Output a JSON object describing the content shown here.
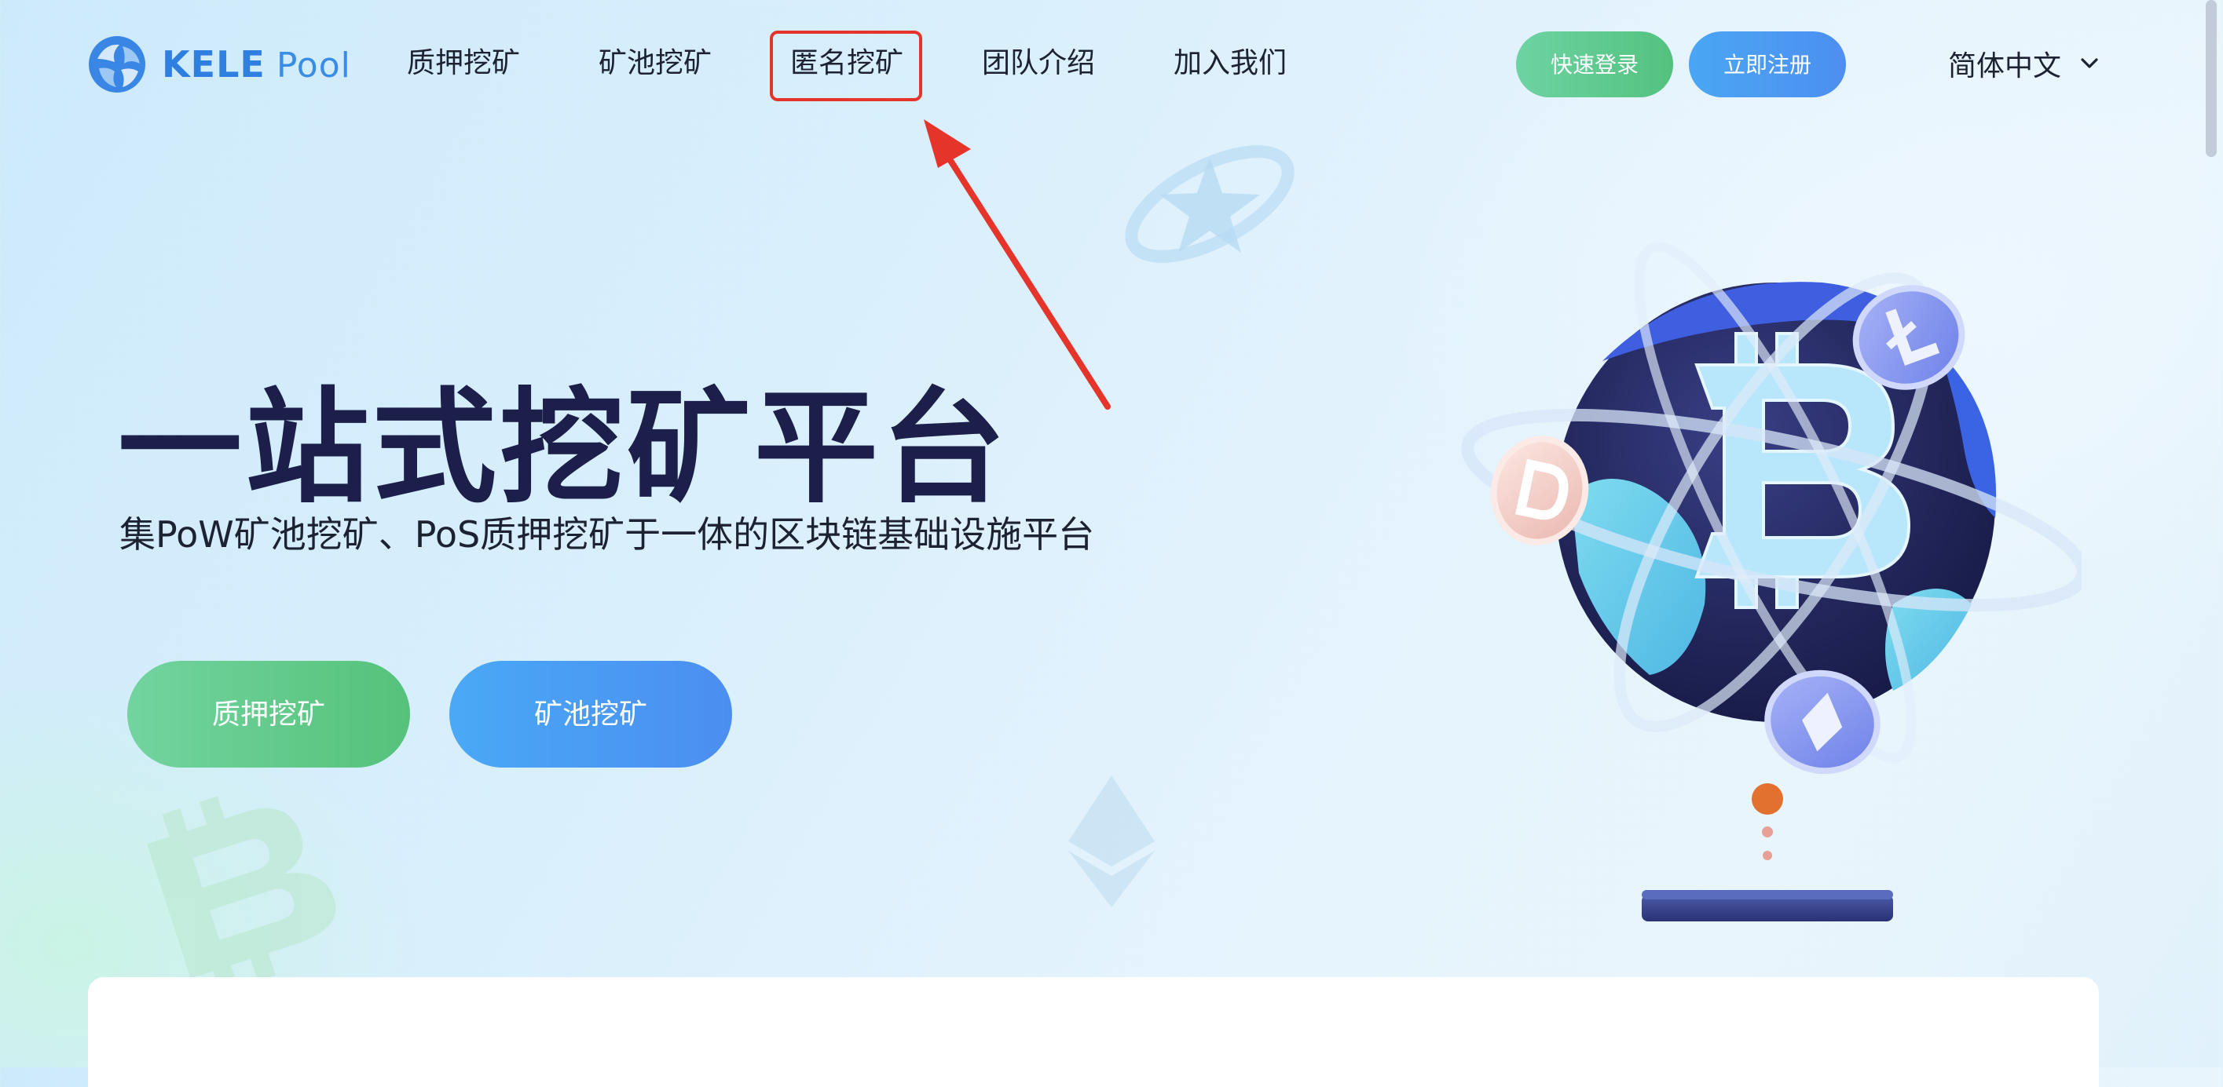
{
  "brand": {
    "name": "KELE",
    "suffix": "Pool",
    "primary_color": "#2f7fe0",
    "logo_icon": "kele-pool-logo-icon"
  },
  "nav": {
    "items": [
      {
        "label": "质押挖矿"
      },
      {
        "label": "矿池挖矿"
      },
      {
        "label": "匿名挖矿",
        "highlighted": true
      },
      {
        "label": "团队介绍"
      },
      {
        "label": "加入我们"
      }
    ]
  },
  "header": {
    "login_label": "快速登录",
    "register_label": "立即注册",
    "language": "简体中文",
    "language_icon": "chevron-down-icon"
  },
  "hero": {
    "title": "一站式挖矿平台",
    "subtitle": "集PoW矿池挖矿、PoS质押挖矿于一体的区块链基础设施平台",
    "cta_stake_label": "质押挖矿",
    "cta_pool_label": "矿池挖矿",
    "illustration": "bitcoin-globe-illustration"
  },
  "annotation": {
    "color": "#e5352b",
    "target": "匿名挖矿"
  },
  "colors": {
    "green_button": "#55c27a",
    "blue_button": "#4b8ef0",
    "title_text": "#1b1f4a"
  }
}
